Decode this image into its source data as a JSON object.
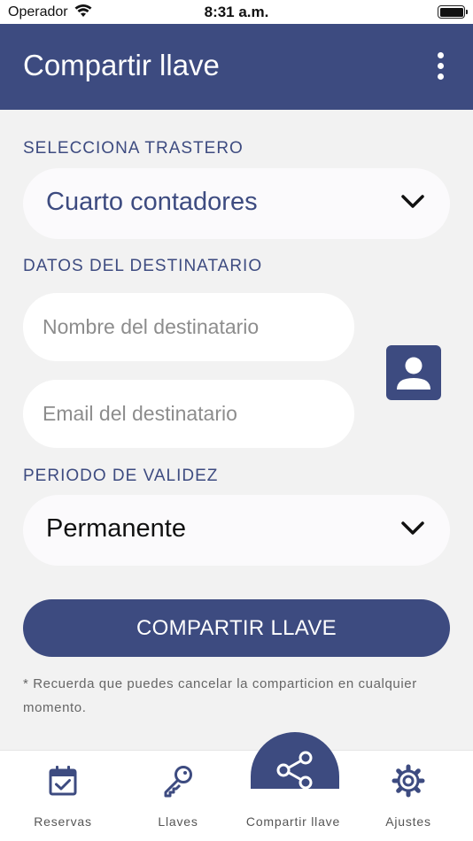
{
  "status_bar": {
    "carrier": "Operador",
    "time": "8:31 a.m."
  },
  "app_bar": {
    "title": "Compartir llave"
  },
  "storage": {
    "label": "SELECCIONA TRASTERO",
    "selected": "Cuarto contadores"
  },
  "recipient": {
    "label": "DATOS DEL DESTINATARIO",
    "name_placeholder": "Nombre del destinatario",
    "email_placeholder": "Email del destinatario"
  },
  "validity": {
    "label": "PERIODO DE VALIDEZ",
    "selected": "Permanente"
  },
  "share_button": "COMPARTIR LLAVE",
  "note": "* Recuerda que puedes cancelar la comparticion en cualquier momento.",
  "tabs": [
    {
      "label": "Reservas",
      "icon": "calendar-check-icon",
      "active": false
    },
    {
      "label": "Llaves",
      "icon": "key-icon",
      "active": false
    },
    {
      "label": "Compartir llave",
      "icon": "share-icon",
      "active": true
    },
    {
      "label": "Ajustes",
      "icon": "gear-icon",
      "active": false
    }
  ],
  "colors": {
    "primary": "#3d4b80",
    "background": "#f2f2f2",
    "field": "#fbfafc"
  }
}
